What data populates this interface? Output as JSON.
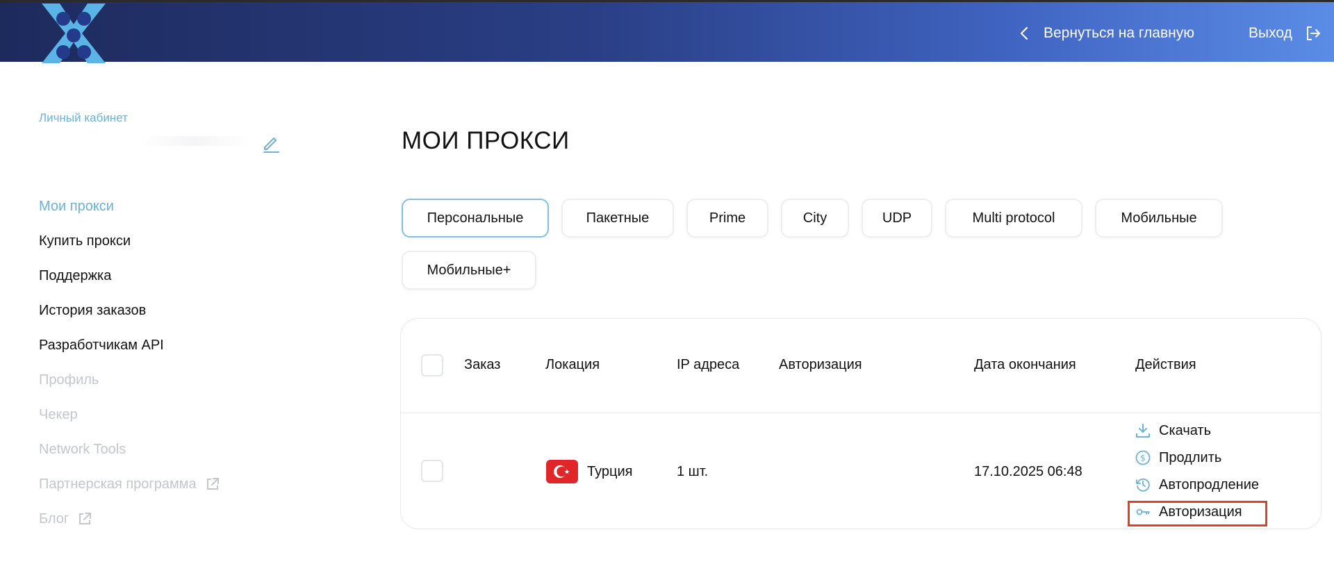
{
  "header": {
    "back_label": "Вернуться на главную",
    "logout_label": "Выход",
    "gradient_start": "#1d2a5c",
    "gradient_end": "#5a8ce6"
  },
  "sidebar": {
    "cabinet_label": "Личный кабинет",
    "items": [
      {
        "label": "Мои прокси",
        "state": "active"
      },
      {
        "label": "Купить прокси",
        "state": "normal"
      },
      {
        "label": "Поддержка",
        "state": "normal"
      },
      {
        "label": "История заказов",
        "state": "normal"
      },
      {
        "label": "Разработчикам API",
        "state": "normal"
      },
      {
        "label": "Профиль",
        "state": "muted"
      },
      {
        "label": "Чекер",
        "state": "muted"
      },
      {
        "label": "Network Tools",
        "state": "muted"
      },
      {
        "label": "Партнерская программа",
        "state": "muted",
        "icon": "external-link-icon"
      },
      {
        "label": "Блог",
        "state": "muted",
        "icon": "external-link-icon"
      }
    ]
  },
  "main": {
    "title": "МОИ ПРОКСИ",
    "tabs": [
      {
        "label": "Персональные",
        "active": true
      },
      {
        "label": "Пакетные"
      },
      {
        "label": "Prime"
      },
      {
        "label": "City"
      },
      {
        "label": "UDP"
      },
      {
        "label": "Multi protocol"
      },
      {
        "label": "Мобильные"
      },
      {
        "label": "Мобильные+"
      }
    ],
    "table": {
      "headers": [
        "Заказ",
        "Локация",
        "IP адреса",
        "Авторизация",
        "Дата окончания",
        "Действия"
      ],
      "rows": [
        {
          "order": "",
          "location": "Турция",
          "flag": "turkey-flag-icon",
          "ip": "1 шт.",
          "auth": "",
          "end_date": "17.10.2025 06:48",
          "actions": [
            {
              "label": "Скачать",
              "icon": "download-icon"
            },
            {
              "label": "Продлить",
              "icon": "dollar-icon"
            },
            {
              "label": "Автопродление",
              "icon": "auto-renew-icon"
            },
            {
              "label": "Авторизация",
              "icon": "key-icon",
              "highlighted": true
            }
          ]
        }
      ]
    }
  },
  "colors": {
    "accent": "#6cb2d8",
    "highlight": "#e0402a",
    "flag_red": "#e1262a"
  }
}
